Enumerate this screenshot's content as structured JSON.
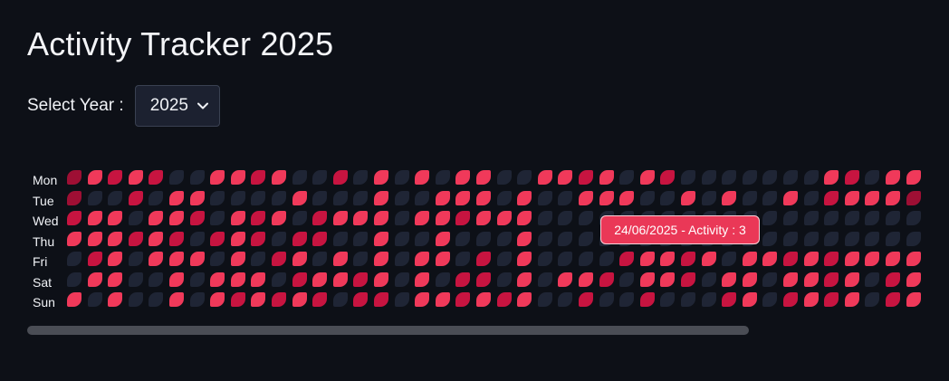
{
  "page": {
    "title": "Activity Tracker 2025"
  },
  "year_picker": {
    "label": "Select Year :",
    "selected": "2025",
    "icon": "chevron-down-icon"
  },
  "heatmap": {
    "days": [
      "Mon",
      "Tue",
      "Wed",
      "Thu",
      "Fri",
      "Sat",
      "Sun"
    ],
    "levels": {
      "0": "#1f2535",
      "1": "#9e0f34",
      "2": "#c71440",
      "3": "#f0395a"
    }
  },
  "tooltip": {
    "text": "24/06/2025 - Activity : 3",
    "date": "24/06/2025",
    "activity": 3
  },
  "chart_data": {
    "type": "heatmap",
    "rows": [
      "Mon",
      "Tue",
      "Wed",
      "Thu",
      "Fri",
      "Sat",
      "Sun"
    ],
    "columns_visible": 42,
    "values": [
      [
        1,
        3,
        2,
        3,
        2,
        0,
        0,
        3,
        3,
        2,
        3,
        0,
        0,
        2,
        0,
        3,
        0,
        3,
        0,
        3,
        3,
        0,
        0,
        3,
        3,
        2,
        3,
        0,
        3,
        2,
        0,
        0,
        0,
        0,
        0,
        0,
        0,
        3,
        2,
        0,
        3,
        3
      ],
      [
        1,
        0,
        0,
        2,
        0,
        3,
        3,
        0,
        0,
        0,
        0,
        3,
        0,
        0,
        0,
        3,
        0,
        0,
        3,
        3,
        3,
        0,
        3,
        0,
        0,
        3,
        3,
        3,
        0,
        0,
        3,
        0,
        3,
        0,
        0,
        3,
        0,
        2,
        3,
        3,
        3,
        1
      ],
      [
        2,
        3,
        3,
        0,
        3,
        3,
        2,
        0,
        3,
        2,
        3,
        0,
        2,
        3,
        3,
        3,
        0,
        3,
        3,
        2,
        3,
        3,
        3,
        0,
        0,
        0,
        0,
        0,
        0,
        0,
        0,
        0,
        0,
        0,
        0,
        0,
        0,
        0,
        0,
        0,
        0,
        0
      ],
      [
        3,
        3,
        3,
        2,
        3,
        2,
        0,
        2,
        3,
        2,
        0,
        2,
        2,
        0,
        0,
        3,
        0,
        0,
        3,
        0,
        0,
        0,
        3,
        0,
        0,
        0,
        0,
        0,
        0,
        0,
        0,
        0,
        0,
        0,
        0,
        0,
        0,
        0,
        0,
        0,
        0,
        0
      ],
      [
        0,
        2,
        3,
        0,
        3,
        3,
        3,
        0,
        3,
        0,
        2,
        3,
        0,
        3,
        0,
        3,
        0,
        3,
        3,
        0,
        2,
        0,
        3,
        0,
        0,
        0,
        0,
        2,
        3,
        3,
        2,
        3,
        0,
        3,
        3,
        2,
        3,
        2,
        3,
        3,
        3,
        3
      ],
      [
        0,
        3,
        3,
        0,
        0,
        3,
        0,
        3,
        3,
        3,
        0,
        2,
        3,
        3,
        2,
        3,
        0,
        3,
        0,
        2,
        2,
        0,
        3,
        0,
        3,
        3,
        2,
        0,
        3,
        3,
        2,
        0,
        3,
        3,
        0,
        3,
        3,
        2,
        3,
        0,
        2,
        3
      ],
      [
        3,
        0,
        3,
        0,
        0,
        3,
        0,
        3,
        2,
        3,
        2,
        3,
        2,
        0,
        2,
        2,
        0,
        3,
        3,
        2,
        3,
        2,
        3,
        0,
        0,
        2,
        0,
        0,
        2,
        0,
        0,
        0,
        2,
        3,
        0,
        2,
        3,
        2,
        3,
        0,
        2,
        3
      ]
    ]
  }
}
